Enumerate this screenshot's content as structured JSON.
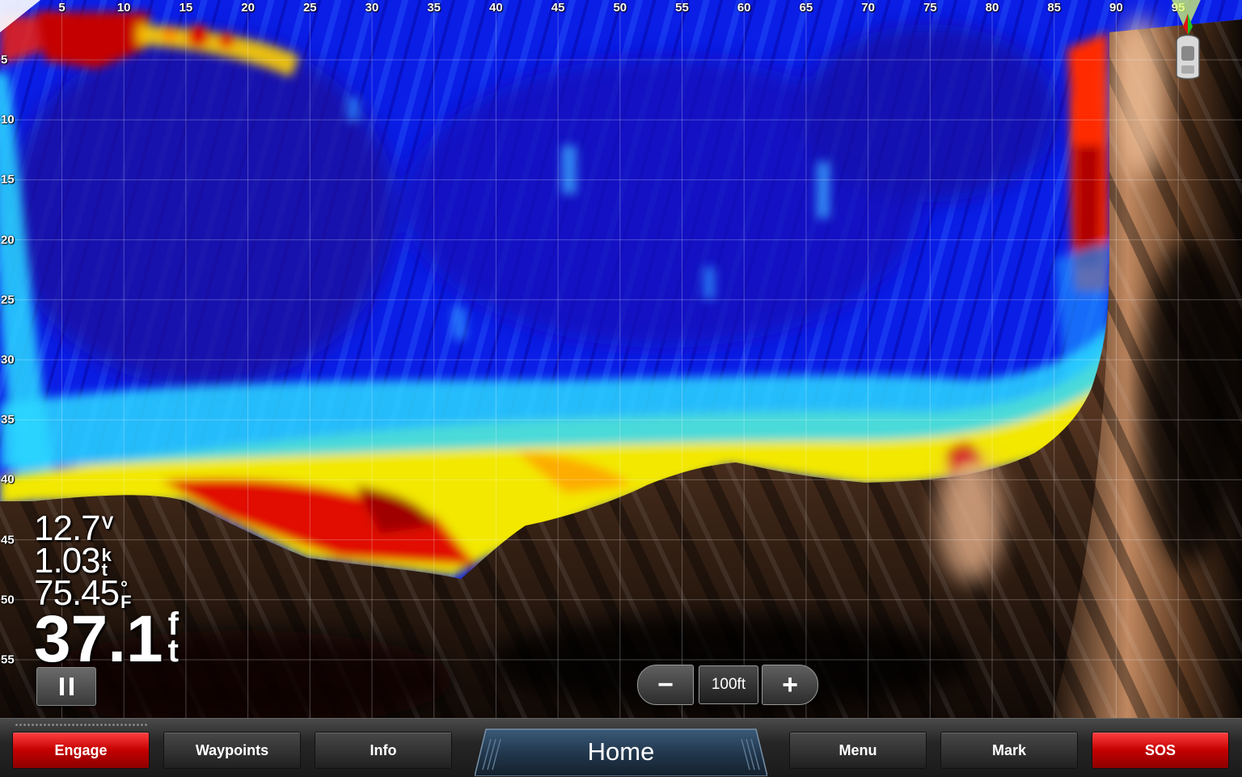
{
  "sonar": {
    "range_x_ticks": [
      "5",
      "10",
      "15",
      "20",
      "25",
      "30",
      "35",
      "40",
      "45",
      "50",
      "55",
      "60",
      "65",
      "70",
      "75",
      "80",
      "85",
      "90",
      "95"
    ],
    "depth_y_ticks": [
      "5",
      "10",
      "15",
      "20",
      "25",
      "30",
      "35",
      "40",
      "45",
      "50",
      "55"
    ],
    "colors": {
      "water": "#0a1ee6",
      "bottom": "#8a5a38",
      "return_red": "#d80000",
      "return_yellow": "#f4ee00"
    }
  },
  "readouts": {
    "voltage": {
      "value": "12.7",
      "unit": [
        "V"
      ]
    },
    "speed": {
      "value": "1.03",
      "unit": [
        "k",
        "t"
      ]
    },
    "temperature": {
      "value": "75.45",
      "unit": [
        "°",
        "F"
      ]
    },
    "depth": {
      "value": "37.1",
      "unit": [
        "f",
        "t"
      ]
    }
  },
  "controls": {
    "pause_icon": "pause-icon",
    "zoom_out_label": "−",
    "zoom_level": "100ft",
    "zoom_in_label": "+"
  },
  "bottom_bar": {
    "engage": "Engage",
    "waypoints": "Waypoints",
    "info": "Info",
    "home": "Home",
    "menu": "Menu",
    "mark": "Mark",
    "sos": "SOS",
    "colors": {
      "red": "#d00000",
      "dark": "#2a2a2a"
    }
  }
}
